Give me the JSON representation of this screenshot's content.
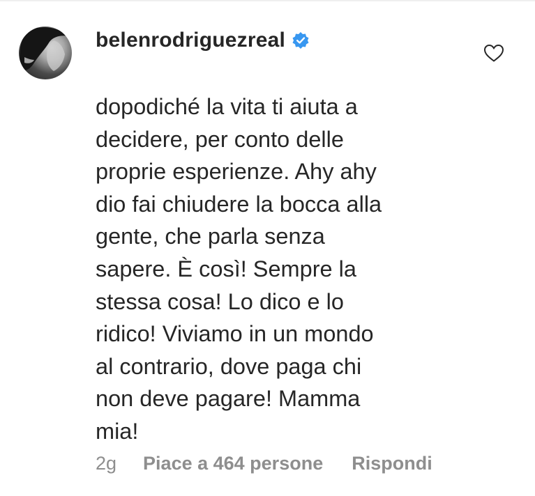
{
  "comment": {
    "username": "belenrodriguezreal",
    "verified_icon": "verified-badge-icon",
    "like_icon": "heart-outline-icon",
    "text_lines": [
      "dopodiché la vita ti aiuta a",
      "decidere, per conto delle",
      "proprie esperienze. Ahy ahy",
      "dio fai chiudere la bocca alla",
      "gente, che parla senza",
      "sapere. È così! Sempre la",
      "stessa cosa! Lo dico e lo",
      "ridico! Viviamo in un mondo",
      "al contrario, dove paga chi",
      "non deve pagare! Mamma",
      "mia!"
    ],
    "timestamp": "2g",
    "likes_label": "Piace a 464 persone",
    "reply_label": "Rispondi"
  },
  "colors": {
    "text": "#262626",
    "secondary": "#8e8e8e",
    "verified": "#3897f0",
    "divider": "#efefef"
  }
}
